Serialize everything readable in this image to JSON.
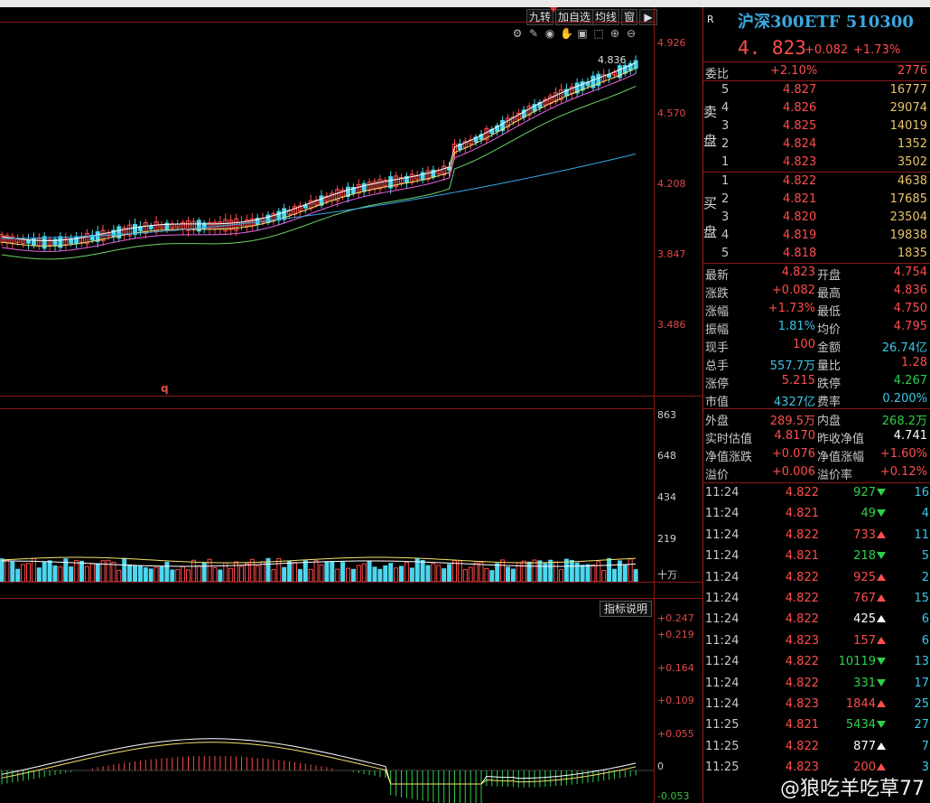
{
  "toolbar": {
    "buttons": [
      "九转",
      "加自选",
      "均线",
      "窗"
    ],
    "icons": [
      "settings-icon",
      "pen-icon",
      "eye-icon",
      "hand-icon",
      "lock-icon",
      "cursor-icon",
      "zoom-in-icon",
      "zoom-out-icon"
    ]
  },
  "main_chart": {
    "price_axis": [
      "4.926",
      "4.570",
      "4.208",
      "3.847",
      "3.486"
    ],
    "last_marker": "4.836",
    "q_label": "q"
  },
  "volume_chart": {
    "axis": [
      "863",
      "648",
      "434",
      "219"
    ],
    "unit": "十万"
  },
  "indicator_chart": {
    "button": "指标说明",
    "axis": [
      "+0.247",
      "+0.219",
      "+0.164",
      "+0.109",
      "+0.055",
      "0",
      "-0.053"
    ]
  },
  "quote": {
    "badge": "R",
    "title": "沪深300ETF 510300",
    "price": "4. 823",
    "change": "+0.082",
    "change_pct": "+1.73%",
    "wei_bi_label": "委比",
    "wei_bi_pct": "+2.10%",
    "wei_bi_val": "2776",
    "sell_label_1": "卖",
    "sell_label_2": "盘",
    "buy_label_1": "买",
    "buy_label_2": "盘",
    "asks": [
      {
        "lvl": "5",
        "price": "4.827",
        "vol": "16777"
      },
      {
        "lvl": "4",
        "price": "4.826",
        "vol": "29074"
      },
      {
        "lvl": "3",
        "price": "4.825",
        "vol": "14019"
      },
      {
        "lvl": "2",
        "price": "4.824",
        "vol": "1352"
      },
      {
        "lvl": "1",
        "price": "4.823",
        "vol": "3502"
      }
    ],
    "bids": [
      {
        "lvl": "1",
        "price": "4.822",
        "vol": "4638"
      },
      {
        "lvl": "2",
        "price": "4.821",
        "vol": "17685"
      },
      {
        "lvl": "3",
        "price": "4.820",
        "vol": "23504"
      },
      {
        "lvl": "4",
        "price": "4.819",
        "vol": "19838"
      },
      {
        "lvl": "5",
        "price": "4.818",
        "vol": "1835"
      }
    ],
    "stats": [
      {
        "l1": "最新",
        "v1": "4.823",
        "c1": "red",
        "l2": "开盘",
        "v2": "4.754",
        "c2": "red"
      },
      {
        "l1": "涨跌",
        "v1": "+0.082",
        "c1": "red",
        "l2": "最高",
        "v2": "4.836",
        "c2": "red"
      },
      {
        "l1": "涨幅",
        "v1": "+1.73%",
        "c1": "red",
        "l2": "最低",
        "v2": "4.750",
        "c2": "red"
      },
      {
        "l1": "振幅",
        "v1": "1.81%",
        "c1": "cyan",
        "l2": "均价",
        "v2": "4.795",
        "c2": "red"
      },
      {
        "l1": "现手",
        "v1": "100",
        "c1": "red",
        "l2": "金额",
        "v2": "26.74亿",
        "c2": "cyan"
      },
      {
        "l1": "总手",
        "v1": "557.7万",
        "c1": "cyan",
        "l2": "量比",
        "v2": "1.28",
        "c2": "red"
      },
      {
        "l1": "涨停",
        "v1": "5.215",
        "c1": "red",
        "l2": "跌停",
        "v2": "4.267",
        "c2": "green"
      },
      {
        "l1": "市值",
        "v1": "4327亿",
        "c1": "cyan",
        "l2": "费率",
        "v2": "0.200%",
        "c2": "cyan"
      }
    ],
    "stats2": [
      {
        "l1": "外盘",
        "v1": "289.5万",
        "c1": "red",
        "l2": "内盘",
        "v2": "268.2万",
        "c2": "green"
      },
      {
        "l1": "实时估值",
        "v1": "4.8170",
        "c1": "red",
        "l2": "昨收净值",
        "v2": "4.741",
        "c2": "white"
      },
      {
        "l1": "净值涨跌",
        "v1": "+0.076",
        "c1": "red",
        "l2": "净值涨幅",
        "v2": "+1.60%",
        "c2": "red"
      },
      {
        "l1": "溢价",
        "v1": "+0.006",
        "c1": "red",
        "l2": "溢价率",
        "v2": "+0.12%",
        "c2": "red"
      }
    ],
    "ticks": [
      {
        "t": "11:24",
        "p": "4.822",
        "pc": "red",
        "v": "927",
        "vc": "green",
        "d": "down",
        "n": "16"
      },
      {
        "t": "11:24",
        "p": "4.821",
        "pc": "red",
        "v": "49",
        "vc": "green",
        "d": "down",
        "n": "4"
      },
      {
        "t": "11:24",
        "p": "4.822",
        "pc": "red",
        "v": "733",
        "vc": "red",
        "d": "up",
        "n": "11"
      },
      {
        "t": "11:24",
        "p": "4.821",
        "pc": "red",
        "v": "218",
        "vc": "green",
        "d": "down",
        "n": "5"
      },
      {
        "t": "11:24",
        "p": "4.822",
        "pc": "red",
        "v": "925",
        "vc": "red",
        "d": "up",
        "n": "2"
      },
      {
        "t": "11:24",
        "p": "4.822",
        "pc": "red",
        "v": "767",
        "vc": "red",
        "d": "up",
        "n": "15"
      },
      {
        "t": "11:24",
        "p": "4.822",
        "pc": "red",
        "v": "425",
        "vc": "white",
        "d": "up",
        "n": "6"
      },
      {
        "t": "11:24",
        "p": "4.823",
        "pc": "red",
        "v": "157",
        "vc": "red",
        "d": "up",
        "n": "6"
      },
      {
        "t": "11:24",
        "p": "4.822",
        "pc": "red",
        "v": "10119",
        "vc": "green",
        "d": "down",
        "n": "13"
      },
      {
        "t": "11:24",
        "p": "4.822",
        "pc": "red",
        "v": "331",
        "vc": "green",
        "d": "down",
        "n": "17"
      },
      {
        "t": "11:24",
        "p": "4.823",
        "pc": "red",
        "v": "1844",
        "vc": "red",
        "d": "up",
        "n": "25"
      },
      {
        "t": "11:25",
        "p": "4.821",
        "pc": "red",
        "v": "5434",
        "vc": "green",
        "d": "down",
        "n": "27"
      },
      {
        "t": "11:25",
        "p": "4.822",
        "pc": "red",
        "v": "877",
        "vc": "white",
        "d": "up",
        "n": "7"
      },
      {
        "t": "11:25",
        "p": "4.823",
        "pc": "red",
        "v": "200",
        "vc": "red",
        "d": "up",
        "n": "3"
      }
    ]
  },
  "watermark": "@狼吃羊吃草77"
}
